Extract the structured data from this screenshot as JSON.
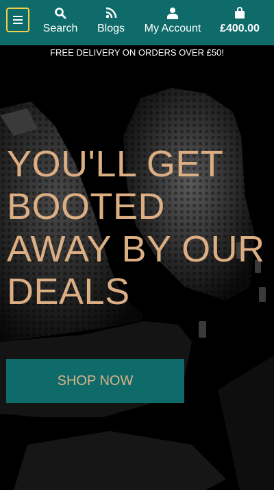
{
  "header": {
    "menu_icon": "hamburger-icon",
    "nav": [
      {
        "label": "Search",
        "icon": "search-icon"
      },
      {
        "label": "Blogs",
        "icon": "rss-icon"
      },
      {
        "label": "My Account",
        "icon": "user-icon"
      },
      {
        "label": "£400.00",
        "icon": "bag-icon"
      }
    ]
  },
  "promo_bar": {
    "text": "FREE DELIVERY ON ORDERS OVER £50!"
  },
  "hero": {
    "title": "YOU'LL GET BOOTED AWAY BY OUR DEALS",
    "cta_label": "SHOP NOW"
  },
  "colors": {
    "header_bg": "#0f6a6a",
    "accent_gold": "#dcae84",
    "menu_outline": "#f2cf48",
    "background": "#000000"
  }
}
